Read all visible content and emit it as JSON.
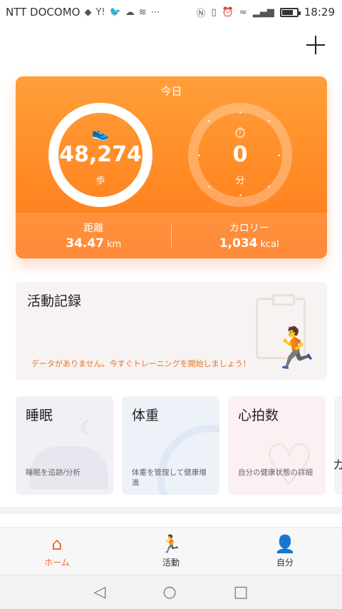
{
  "status_bar": {
    "carrier": "NTT DOCOMO",
    "notif_icons": [
      "cube-icon",
      "yahoo-icon",
      "twitter-icon",
      "cloud-icon",
      "wifi-calling-icon",
      "more-dots-icon"
    ],
    "system_icons": [
      "nfc-icon",
      "vibrate-icon",
      "alarm-icon",
      "wifi-icon",
      "signal-4g-icon",
      "battery-icon"
    ],
    "time": "18:29"
  },
  "header": {
    "add_icon": "plus-icon"
  },
  "today_card": {
    "title": "今日",
    "steps": {
      "value": "48,274",
      "unit": "歩",
      "icon": "shoe-icon"
    },
    "minutes": {
      "value": "0",
      "unit": "分",
      "icon": "stopwatch-icon"
    },
    "distance": {
      "label": "距離",
      "value": "34.47",
      "unit": "km"
    },
    "calories": {
      "label": "カロリー",
      "value": "1,034",
      "unit": "kcal"
    },
    "colors": {
      "accent": "#ff8a25"
    }
  },
  "activity": {
    "title": "活動記録",
    "message": "データがありません。今すぐトレーニングを開始しましょう！"
  },
  "tiles": [
    {
      "title": "睡眠",
      "desc": "睡眠を追跡/分析"
    },
    {
      "title": "体重",
      "desc": "体重を管理して健康増進"
    },
    {
      "title": "心拍数",
      "desc": "自分の健康状態の詳細"
    },
    {
      "title": "カ"
    }
  ],
  "bottom_nav": [
    {
      "label": "ホーム",
      "icon": "home-icon",
      "active": true
    },
    {
      "label": "活動",
      "icon": "running-icon",
      "active": false
    },
    {
      "label": "自分",
      "icon": "person-icon",
      "active": false
    }
  ],
  "system_nav": [
    "back-icon",
    "home-circle-icon",
    "recents-icon"
  ]
}
